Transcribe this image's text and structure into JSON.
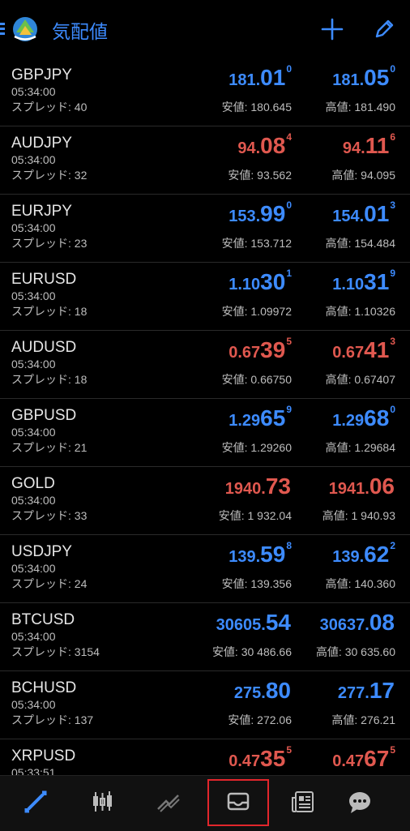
{
  "header": {
    "title": "気配値"
  },
  "colors": {
    "accent": "#3d8bff",
    "down": "#e0584f",
    "active_outline": "#e2262c"
  },
  "quotes": [
    {
      "symbol": "GBPJPY",
      "time": "05:34:00",
      "spread": "スプレッド: 40",
      "dir": "blue",
      "bid": {
        "main": "181.",
        "big": "01",
        "sup": "0"
      },
      "ask": {
        "main": "181.",
        "big": "05",
        "sup": "0"
      },
      "low": "安値: 180.645",
      "high": "高値: 181.490"
    },
    {
      "symbol": "AUDJPY",
      "time": "05:34:00",
      "spread": "スプレッド: 32",
      "dir": "red",
      "bid": {
        "main": "94.",
        "big": "08",
        "sup": "4"
      },
      "ask": {
        "main": "94.",
        "big": "11",
        "sup": "6"
      },
      "low": "安値: 93.562",
      "high": "高値: 94.095"
    },
    {
      "symbol": "EURJPY",
      "time": "05:34:00",
      "spread": "スプレッド: 23",
      "dir": "blue",
      "bid": {
        "main": "153.",
        "big": "99",
        "sup": "0"
      },
      "ask": {
        "main": "154.",
        "big": "01",
        "sup": "3"
      },
      "low": "安値: 153.712",
      "high": "高値: 154.484"
    },
    {
      "symbol": "EURUSD",
      "time": "05:34:00",
      "spread": "スプレッド: 18",
      "dir": "blue",
      "bid": {
        "main": "1.10",
        "big": "30",
        "sup": "1"
      },
      "ask": {
        "main": "1.10",
        "big": "31",
        "sup": "9"
      },
      "low": "安値: 1.09972",
      "high": "高値: 1.10326"
    },
    {
      "symbol": "AUDUSD",
      "time": "05:34:00",
      "spread": "スプレッド: 18",
      "dir": "red",
      "bid": {
        "main": "0.67",
        "big": "39",
        "sup": "5"
      },
      "ask": {
        "main": "0.67",
        "big": "41",
        "sup": "3"
      },
      "low": "安値: 0.66750",
      "high": "高値: 0.67407"
    },
    {
      "symbol": "GBPUSD",
      "time": "05:34:00",
      "spread": "スプレッド: 21",
      "dir": "blue",
      "bid": {
        "main": "1.29",
        "big": "65",
        "sup": "9"
      },
      "ask": {
        "main": "1.29",
        "big": "68",
        "sup": "0"
      },
      "low": "安値: 1.29260",
      "high": "高値: 1.29684"
    },
    {
      "symbol": "GOLD",
      "time": "05:34:00",
      "spread": "スプレッド: 33",
      "dir": "red",
      "bid": {
        "main": "1940.",
        "big": "73",
        "sup": ""
      },
      "ask": {
        "main": "1941.",
        "big": "06",
        "sup": ""
      },
      "low": "安値: 1 932.04",
      "high": "高値: 1 940.93"
    },
    {
      "symbol": "USDJPY",
      "time": "05:34:00",
      "spread": "スプレッド: 24",
      "dir": "blue",
      "bid": {
        "main": "139.",
        "big": "59",
        "sup": "8"
      },
      "ask": {
        "main": "139.",
        "big": "62",
        "sup": "2"
      },
      "low": "安値: 139.356",
      "high": "高値: 140.360"
    },
    {
      "symbol": "BTCUSD",
      "time": "05:34:00",
      "spread": "スプレッド: 3154",
      "dir": "blue",
      "bid": {
        "main": "30605.",
        "big": "54",
        "sup": ""
      },
      "ask": {
        "main": "30637.",
        "big": "08",
        "sup": ""
      },
      "low": "安値: 30 486.66",
      "high": "高値: 30 635.60"
    },
    {
      "symbol": "BCHUSD",
      "time": "05:34:00",
      "spread": "スプレッド: 137",
      "dir": "blue",
      "bid": {
        "main": "275.",
        "big": "80",
        "sup": ""
      },
      "ask": {
        "main": "277.",
        "big": "17",
        "sup": ""
      },
      "low": "安値: 272.06",
      "high": "高値: 276.21"
    },
    {
      "symbol": "XRPUSD",
      "time": "05:33:51",
      "spread": "",
      "dir": "red",
      "bid": {
        "main": "0.47",
        "big": "35",
        "sup": "5"
      },
      "ask": {
        "main": "0.47",
        "big": "67",
        "sup": "5"
      },
      "low": "",
      "high": ""
    }
  ],
  "bottom_nav": [
    {
      "icon": "quotes-icon",
      "active": false
    },
    {
      "icon": "chart-icon",
      "active": false
    },
    {
      "icon": "trade-icon",
      "active": false
    },
    {
      "icon": "inbox-icon",
      "active": true
    },
    {
      "icon": "news-icon",
      "active": false
    },
    {
      "icon": "chat-icon",
      "active": false
    }
  ]
}
